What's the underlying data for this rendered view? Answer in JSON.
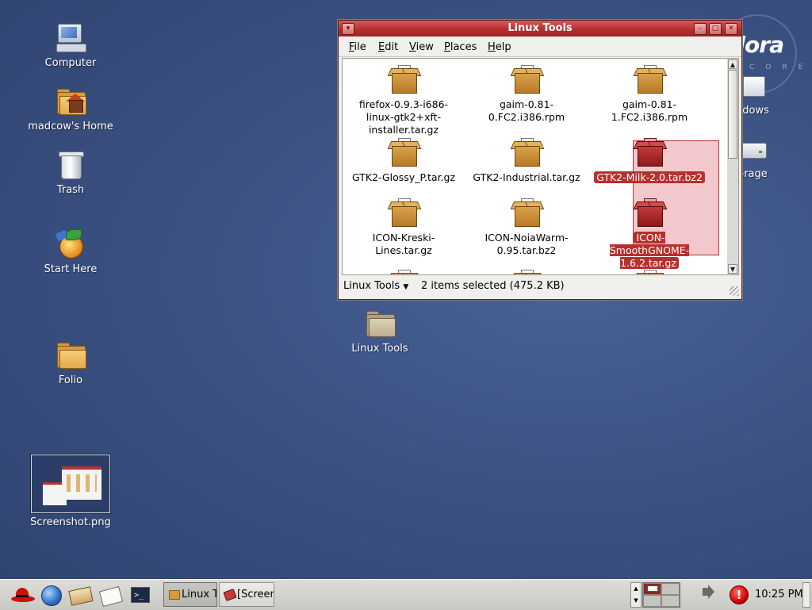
{
  "desktop": {
    "brand": "dora",
    "brand_sub": "CORE",
    "icons": [
      {
        "label": "Computer"
      },
      {
        "label": "madcow's Home"
      },
      {
        "label": "Trash"
      },
      {
        "label": "Start Here"
      },
      {
        "label": "Folio"
      },
      {
        "label": "Screenshot.png"
      },
      {
        "label": "Linux Tools"
      },
      {
        "label": "ndows"
      },
      {
        "label": "orage"
      }
    ]
  },
  "window": {
    "title": "Linux Tools",
    "menu": [
      {
        "u": "F",
        "rest": "ile"
      },
      {
        "u": "E",
        "rest": "dit"
      },
      {
        "u": "V",
        "rest": "iew"
      },
      {
        "u": "P",
        "rest": "laces"
      },
      {
        "u": "H",
        "rest": "elp"
      }
    ],
    "files": [
      {
        "name": "firefox-0.9.3-i686-linux-gtk2+xft-installer.tar.gz",
        "selected": false
      },
      {
        "name": "gaim-0.81-0.FC2.i386.rpm",
        "selected": false
      },
      {
        "name": "gaim-0.81-1.FC2.i386.rpm",
        "selected": false
      },
      {
        "name": "GTK2-Glossy_P.tar.gz",
        "selected": false
      },
      {
        "name": "GTK2-Industrial.tar.gz",
        "selected": false
      },
      {
        "name": "GTK2-Milk-2.0.tar.bz2",
        "selected": true
      },
      {
        "name": "ICON-Kreski-Lines.tar.gz",
        "selected": false
      },
      {
        "name": "ICON-NoiaWarm-0.95.tar.bz2",
        "selected": false
      },
      {
        "name": "ICON-SmoothGNOME-1.6.2.tar.gz",
        "selected": true
      }
    ],
    "location": "Linux Tools",
    "status": "2 items selected (475.2 KB)"
  },
  "panel": {
    "tasks": [
      {
        "label": "Linux T"
      },
      {
        "label": "[Screen"
      }
    ],
    "clock": "10:25 PM"
  }
}
